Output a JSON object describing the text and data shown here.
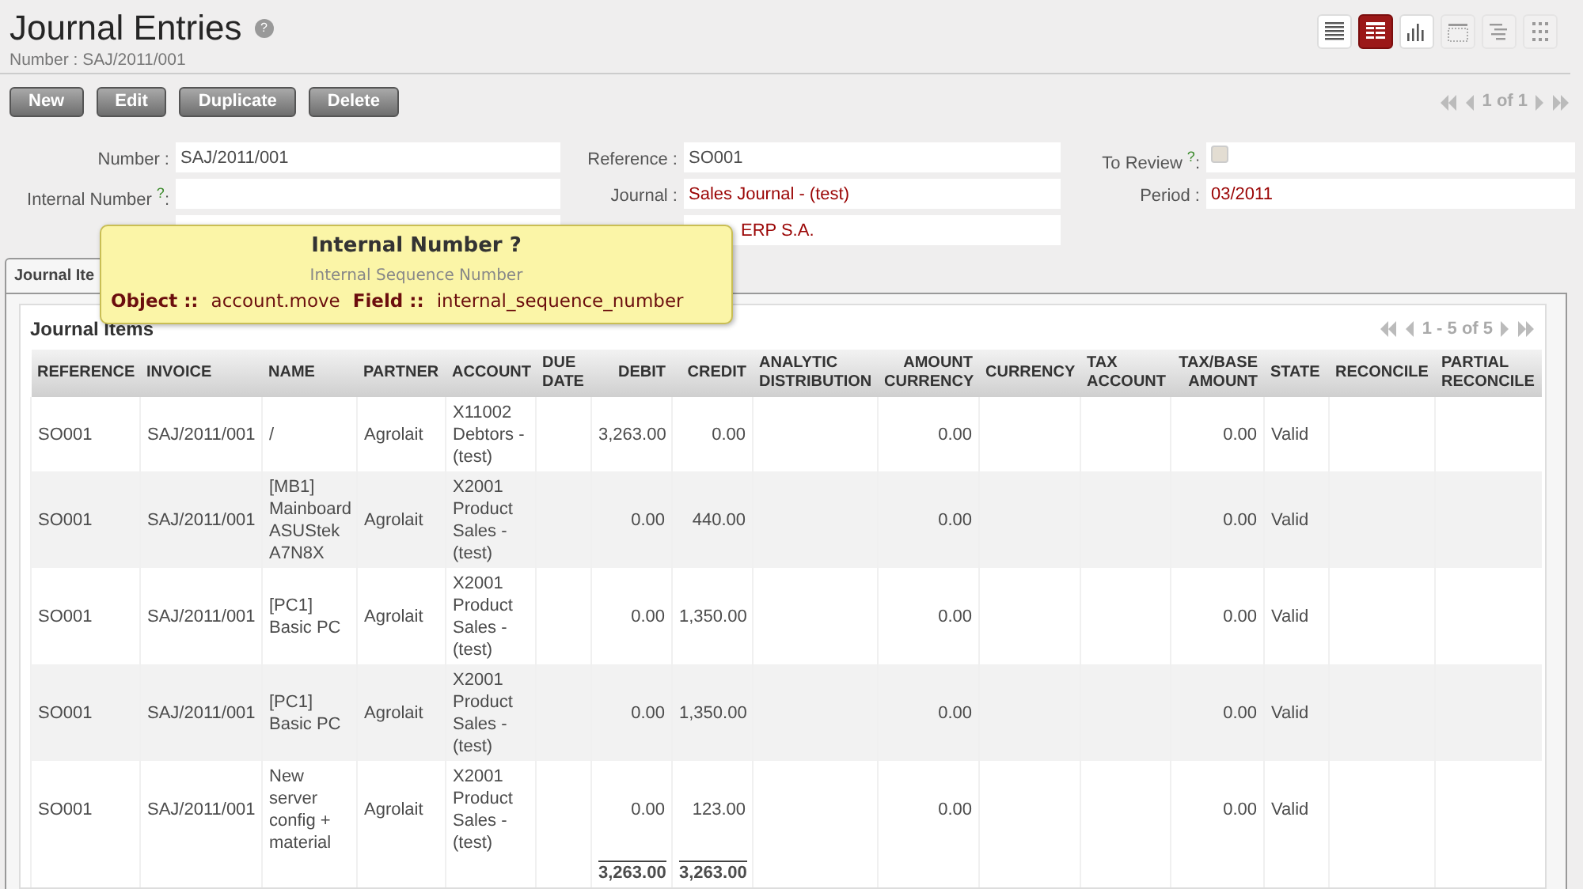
{
  "header": {
    "title": "Journal Entries",
    "help": "?",
    "subtitle": "Number : SAJ/2011/001"
  },
  "views": [
    {
      "kind": "list",
      "selected": false,
      "disabled": false
    },
    {
      "kind": "form",
      "selected": true,
      "disabled": false
    },
    {
      "kind": "graph",
      "selected": false,
      "disabled": false
    },
    {
      "kind": "calendar",
      "selected": false,
      "disabled": true
    },
    {
      "kind": "gantt",
      "selected": false,
      "disabled": true
    },
    {
      "kind": "kanban",
      "selected": false,
      "disabled": true
    }
  ],
  "buttons": [
    "New",
    "Edit",
    "Duplicate",
    "Delete"
  ],
  "pager": {
    "text": "1 of 1",
    "disabled": true
  },
  "form": [
    [
      {
        "label": "Number :",
        "kind": "text",
        "value": "SAJ/2011/001"
      },
      {
        "label": "Reference :",
        "kind": "text",
        "value": "SO001"
      },
      {
        "label": "To Review",
        "help": "?",
        "suffix": ":",
        "kind": "checkbox",
        "checked": false
      }
    ],
    [
      {
        "label": "Internal Number",
        "help": "?",
        "suffix": ":",
        "kind": "text"
      },
      {
        "label": "Journal :",
        "kind": "link",
        "value": "Sales Journal - (test)"
      },
      {
        "label": "Period :",
        "kind": "link",
        "value": "03/2011"
      }
    ],
    [
      {
        "kind": "text"
      },
      {
        "kind": "link",
        "value": "ERP S.A.",
        "covered": true
      }
    ]
  ],
  "tabs": [
    {
      "label": "Journal Ite",
      "selected": true
    }
  ],
  "tooltip": {
    "title": "Internal Number ?",
    "subtitle": "Internal Sequence Number",
    "object_label": "Object ::",
    "object": "account.move",
    "field_label": "Field ::",
    "field": "internal_sequence_number"
  },
  "items": {
    "title": "Journal Items",
    "pager": "1 - 5 of 5",
    "columns": [
      {
        "label": "REFERENCE"
      },
      {
        "label": "INVOICE",
        "numeric": false
      },
      {
        "label": "NAME",
        "numeric": false
      },
      {
        "label": "PARTNER",
        "numeric": false
      },
      {
        "label": "ACCOUNT"
      },
      {
        "label": "DUE DATE",
        "numeric": false
      },
      {
        "label": "DEBIT",
        "numeric": true
      },
      {
        "label": "CREDIT",
        "numeric": true
      },
      {
        "label": "ANALYTIC DISTRIBUTION",
        "numeric": false
      },
      {
        "label": "AMOUNT CURRENCY",
        "numeric": true
      },
      {
        "label": "CURRENCY"
      },
      {
        "label": "TAX ACCOUNT",
        "numeric": false
      },
      {
        "label": "TAX/BASE AMOUNT",
        "numeric": true
      },
      {
        "label": "STATE",
        "numeric": false
      },
      {
        "label": "RECONCILE",
        "numeric": false
      },
      {
        "label": "PARTIAL RECONCILE",
        "numeric": false
      }
    ],
    "rows": [
      [
        "SO001",
        "SAJ/2011/001",
        "/",
        "Agrolait",
        "X11002 Debtors - (test)",
        null,
        "3,263.00",
        "0.00",
        null,
        "0.00",
        null,
        null,
        "0.00",
        "Valid",
        null,
        null
      ],
      [
        "SO001",
        "SAJ/2011/001",
        "[MB1] Mainboard ASUStek A7N8X",
        "Agrolait",
        "X2001 Product Sales - (test)",
        null,
        "0.00",
        "440.00",
        null,
        "0.00",
        null,
        null,
        "0.00",
        "Valid",
        null,
        null
      ],
      [
        "SO001",
        "SAJ/2011/001",
        "[PC1] Basic PC",
        "Agrolait",
        "X2001 Product Sales - (test)",
        null,
        "0.00",
        "1,350.00",
        null,
        "0.00",
        null,
        null,
        "0.00",
        "Valid",
        null,
        null
      ],
      [
        "SO001",
        "SAJ/2011/001",
        "[PC1] Basic PC",
        "Agrolait",
        "X2001 Product Sales - (test)",
        null,
        "0.00",
        "1,350.00",
        null,
        "0.00",
        null,
        null,
        "0.00",
        "Valid",
        null,
        null
      ],
      [
        "SO001",
        "SAJ/2011/001",
        "New server config + material",
        "Agrolait",
        "X2001 Product Sales - (test)",
        null,
        "0.00",
        "123.00",
        null,
        "0.00",
        null,
        null,
        "0.00",
        "Valid",
        null,
        null
      ]
    ],
    "totals": {
      "debit": "3,263.00",
      "credit": "3,263.00"
    }
  }
}
